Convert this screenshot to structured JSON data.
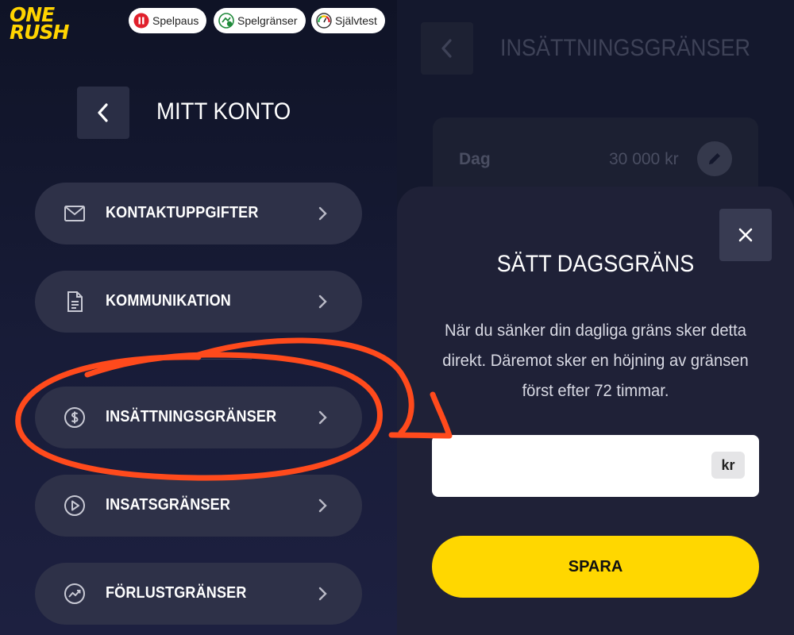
{
  "brand": {
    "logo_line1": "ONE",
    "logo_line2": "RUSH",
    "color": "#ffd400"
  },
  "top_pills": [
    {
      "label": "Spelpaus",
      "icon": "pause-icon"
    },
    {
      "label": "Spelgränser",
      "icon": "limits-icon"
    },
    {
      "label": "Självtest",
      "icon": "gauge-icon"
    }
  ],
  "account": {
    "title": "MITT KONTO",
    "menu": [
      {
        "label": "KONTAKTUPPGIFTER",
        "icon": "mail-icon"
      },
      {
        "label": "KOMMUNIKATION",
        "icon": "document-icon"
      },
      {
        "label": "INSÄTTNINGSGRÄNSER",
        "icon": "dollar-circle-icon"
      },
      {
        "label": "INSATSGRÄNSER",
        "icon": "play-circle-icon"
      },
      {
        "label": "FÖRLUSTGRÄNSER",
        "icon": "trend-circle-icon"
      }
    ]
  },
  "limits_page": {
    "title": "INSÄTTNINGSGRÄNSER",
    "rows": [
      {
        "period": "Dag",
        "amount": "30 000 kr"
      }
    ]
  },
  "modal": {
    "title": "SÄTT DAGSGRÄNS",
    "text": "När du sänker din dagliga gräns sker detta direkt. Däremot sker en höjning av gränsen först efter 72 timmar.",
    "amount_value": "",
    "unit": "kr",
    "save_label": "SPARA"
  },
  "colors": {
    "accent": "#ffd700",
    "annotation": "#ff4a1c",
    "panel_bg": "#14182d"
  }
}
